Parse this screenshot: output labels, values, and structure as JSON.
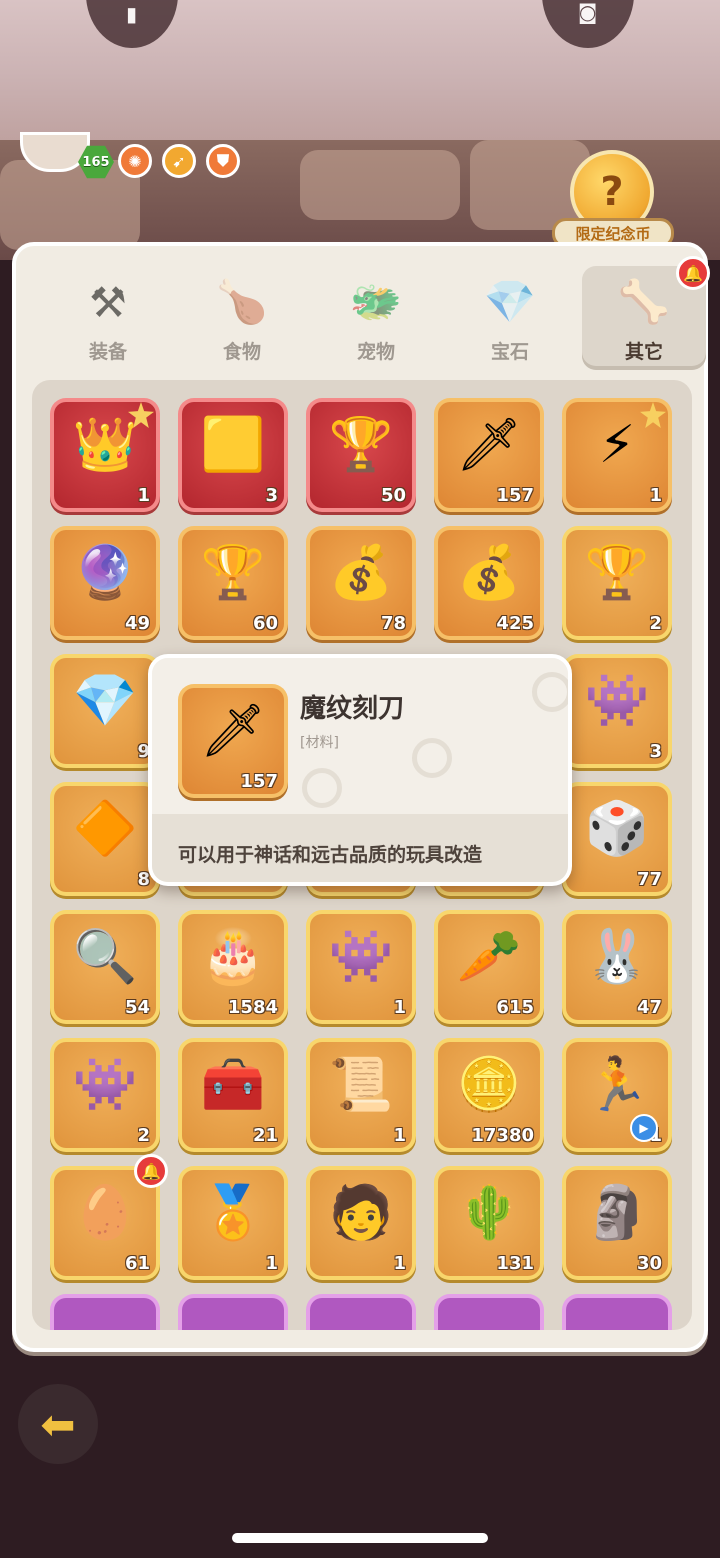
{
  "status": {
    "level": "165",
    "buff_icons": [
      "fire-buff-icon",
      "speed-buff-icon",
      "shield-buff-icon"
    ]
  },
  "limited_coin": {
    "label": "限定纪念币",
    "glyph": "?"
  },
  "tabs": [
    {
      "label": "装备",
      "icon": "hammer-icon",
      "glyph": "⚒",
      "active": false
    },
    {
      "label": "食物",
      "icon": "food-bowl-icon",
      "glyph": "🍗",
      "active": false
    },
    {
      "label": "宠物",
      "icon": "pet-skull-icon",
      "glyph": "🐲",
      "active": false
    },
    {
      "label": "宝石",
      "icon": "gem-icon",
      "glyph": "💎",
      "active": false
    },
    {
      "label": "其它",
      "icon": "bone-icon",
      "glyph": "🦴",
      "active": true
    }
  ],
  "items": [
    {
      "icon": "winged-chest-icon",
      "glyph": "👑",
      "count": "1",
      "rarity": "red",
      "star": true
    },
    {
      "icon": "gold-ore-icon",
      "glyph": "🟨",
      "count": "3",
      "rarity": "red",
      "star": false
    },
    {
      "icon": "golden-totem-icon",
      "glyph": "🏆",
      "count": "50",
      "rarity": "red",
      "star": false
    },
    {
      "icon": "rune-knife-icon",
      "glyph": "🗡",
      "count": "157",
      "rarity": "orange",
      "star": false
    },
    {
      "icon": "lightning-chest-icon",
      "glyph": "⚡",
      "count": "1",
      "rarity": "orange",
      "star": true
    },
    {
      "icon": "purple-orb-totem-icon",
      "glyph": "🔮",
      "count": "49",
      "rarity": "orange",
      "star": false
    },
    {
      "icon": "golden-totem-icon",
      "glyph": "🏆",
      "count": "60",
      "rarity": "orange",
      "star": false
    },
    {
      "icon": "lightning-bag-icon",
      "glyph": "💰",
      "count": "78",
      "rarity": "orange",
      "star": false
    },
    {
      "icon": "blue-bag-icon",
      "glyph": "💰",
      "count": "425",
      "rarity": "orange",
      "star": false
    },
    {
      "icon": "red-totem-icon",
      "glyph": "🏆",
      "count": "2",
      "rarity": "gold",
      "star": false
    },
    {
      "icon": "blue-crystal-icon",
      "glyph": "💎",
      "count": "9",
      "rarity": "gold",
      "star": false
    },
    {
      "icon": "hidden-item-icon",
      "glyph": "",
      "count": "",
      "rarity": "gold",
      "star": false
    },
    {
      "icon": "hidden-item-icon",
      "glyph": "",
      "count": "",
      "rarity": "gold",
      "star": false
    },
    {
      "icon": "hidden-item-icon",
      "glyph": "",
      "count": "",
      "rarity": "gold",
      "star": false
    },
    {
      "icon": "purple-ghost-bag-icon",
      "glyph": "👾",
      "count": "3",
      "rarity": "gold",
      "star": false
    },
    {
      "icon": "yellow-crystal-icon",
      "glyph": "🔶",
      "count": "8",
      "rarity": "gold",
      "star": false
    },
    {
      "icon": "hidden-item-icon",
      "glyph": "",
      "count": "",
      "rarity": "gold",
      "star": false
    },
    {
      "icon": "hidden-item-icon",
      "glyph": "",
      "count": "",
      "rarity": "gold",
      "star": false
    },
    {
      "icon": "hidden-item-icon",
      "glyph": "",
      "count": "",
      "rarity": "gold",
      "star": false
    },
    {
      "icon": "dice-icon",
      "glyph": "🎲",
      "count": "77",
      "rarity": "gold",
      "star": false
    },
    {
      "icon": "magnifier-icon",
      "glyph": "🔍",
      "count": "54",
      "rarity": "gold",
      "star": false
    },
    {
      "icon": "cake-coin-icon",
      "glyph": "🎂",
      "count": "1584",
      "rarity": "gold",
      "star": false
    },
    {
      "icon": "purple-ghost-bag-icon",
      "glyph": "👾",
      "count": "1",
      "rarity": "gold",
      "star": false
    },
    {
      "icon": "carrot-bag-icon",
      "glyph": "🥕",
      "count": "615",
      "rarity": "gold",
      "star": false
    },
    {
      "icon": "bunny-bag-icon",
      "glyph": "🐰",
      "count": "47",
      "rarity": "gold",
      "star": false
    },
    {
      "icon": "purple-ghost-bag-icon",
      "glyph": "👾",
      "count": "2",
      "rarity": "gold",
      "star": false
    },
    {
      "icon": "iron-chest-icon",
      "glyph": "🧰",
      "count": "21",
      "rarity": "gold",
      "star": false
    },
    {
      "icon": "winged-tablet-icon",
      "glyph": "📜",
      "count": "1",
      "rarity": "gold",
      "star": false
    },
    {
      "icon": "gold-coin-icon",
      "glyph": "🪙",
      "count": "17380",
      "rarity": "gold",
      "star": false
    },
    {
      "icon": "blue-runner-icon",
      "glyph": "🏃",
      "count": "1",
      "rarity": "gold",
      "star": false,
      "play": true
    },
    {
      "icon": "golden-egg-icon",
      "glyph": "🥚",
      "count": "61",
      "rarity": "gold",
      "star": false,
      "bell": true
    },
    {
      "icon": "medal-icon",
      "glyph": "🏅",
      "count": "1",
      "rarity": "gold",
      "star": false
    },
    {
      "icon": "portrait-card-icon",
      "glyph": "🧑",
      "count": "1",
      "rarity": "gold",
      "star": false
    },
    {
      "icon": "cactus-statue-icon",
      "glyph": "🌵",
      "count": "131",
      "rarity": "gold",
      "star": false
    },
    {
      "icon": "stone-idol-icon",
      "glyph": "🗿",
      "count": "30",
      "rarity": "gold",
      "star": false
    },
    {
      "icon": "crystal-icon",
      "glyph": "",
      "count": "",
      "rarity": "purple",
      "star": false
    },
    {
      "icon": "scroll-icon",
      "glyph": "",
      "count": "",
      "rarity": "purple",
      "star": false
    },
    {
      "icon": "orb-icon",
      "glyph": "",
      "count": "",
      "rarity": "purple",
      "star": false
    },
    {
      "icon": "leaf-icon",
      "glyph": "",
      "count": "",
      "rarity": "purple",
      "star": false
    },
    {
      "icon": "gem-icon",
      "glyph": "",
      "count": "",
      "rarity": "purple",
      "star": false
    }
  ],
  "tooltip": {
    "name": "魔纹刻刀",
    "type": "[材料]",
    "count": "157",
    "icon": "rune-knife-icon",
    "glyph": "🗡",
    "description": "可以用于神话和远古品质的玩具改造"
  },
  "nav": {
    "back_icon": "back-arrow-icon",
    "back_glyph": "⬅"
  }
}
